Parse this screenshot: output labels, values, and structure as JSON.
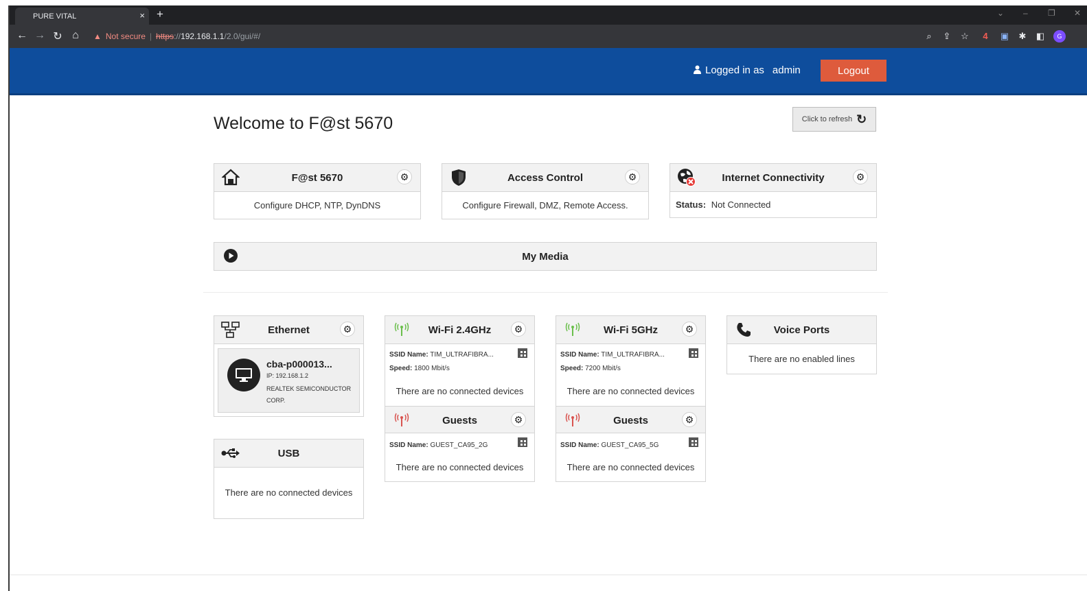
{
  "browser": {
    "tab_title": "PURE VITAL",
    "tab_close": "×",
    "new_tab": "+",
    "not_secure": "Not secure",
    "url_scheme": "https",
    "url_rest_sep": "://",
    "url_host": "192.168.1.1",
    "url_path": "/2.0/gui/#/",
    "extension_badge": "4"
  },
  "header": {
    "logged_in_label": "Logged in as",
    "username": "admin",
    "logout_label": "Logout"
  },
  "page": {
    "title": "Welcome to F@st 5670",
    "refresh_label": "Click to refresh"
  },
  "cards": {
    "device": {
      "title": "F@st 5670",
      "body": "Configure DHCP, NTP, DynDNS"
    },
    "access": {
      "title": "Access Control",
      "body": "Configure Firewall, DMZ, Remote Access."
    },
    "internet": {
      "title": "Internet Connectivity",
      "status_label": "Status:",
      "status_value": "Not Connected"
    },
    "media": {
      "title": "My Media"
    },
    "ethernet": {
      "title": "Ethernet",
      "device_name": "cba-p000013...",
      "device_ip": "IP: 192.168.1.2",
      "device_vendor": "REALTEK SEMICONDUCTOR CORP."
    },
    "usb": {
      "title": "USB",
      "body": "There are no connected devices"
    },
    "wifi24": {
      "title": "Wi-Fi 2.4GHz",
      "ssid_label": "SSID Name:",
      "ssid": "TIM_ULTRAFIBRA...",
      "speed_label": "Speed:",
      "speed": "1800 Mbit/s",
      "devices": "There are no connected devices",
      "guests_title": "Guests",
      "guest_ssid": "GUEST_CA95_2G",
      "guest_devices": "There are no connected devices"
    },
    "wifi5": {
      "title": "Wi-Fi 5GHz",
      "ssid_label": "SSID Name:",
      "ssid": "TIM_ULTRAFIBRA...",
      "speed_label": "Speed:",
      "speed": "7200 Mbit/s",
      "devices": "There are no connected devices",
      "guests_title": "Guests",
      "guest_ssid": "GUEST_CA95_5G",
      "guest_devices": "There are no connected devices"
    },
    "voice": {
      "title": "Voice Ports",
      "body": "There are no enabled lines"
    }
  },
  "colors": {
    "header_blue": "#0e4d9c",
    "logout_orange": "#de5b3c",
    "wifi_green": "#6abf4b",
    "guest_red": "#d9534f"
  }
}
